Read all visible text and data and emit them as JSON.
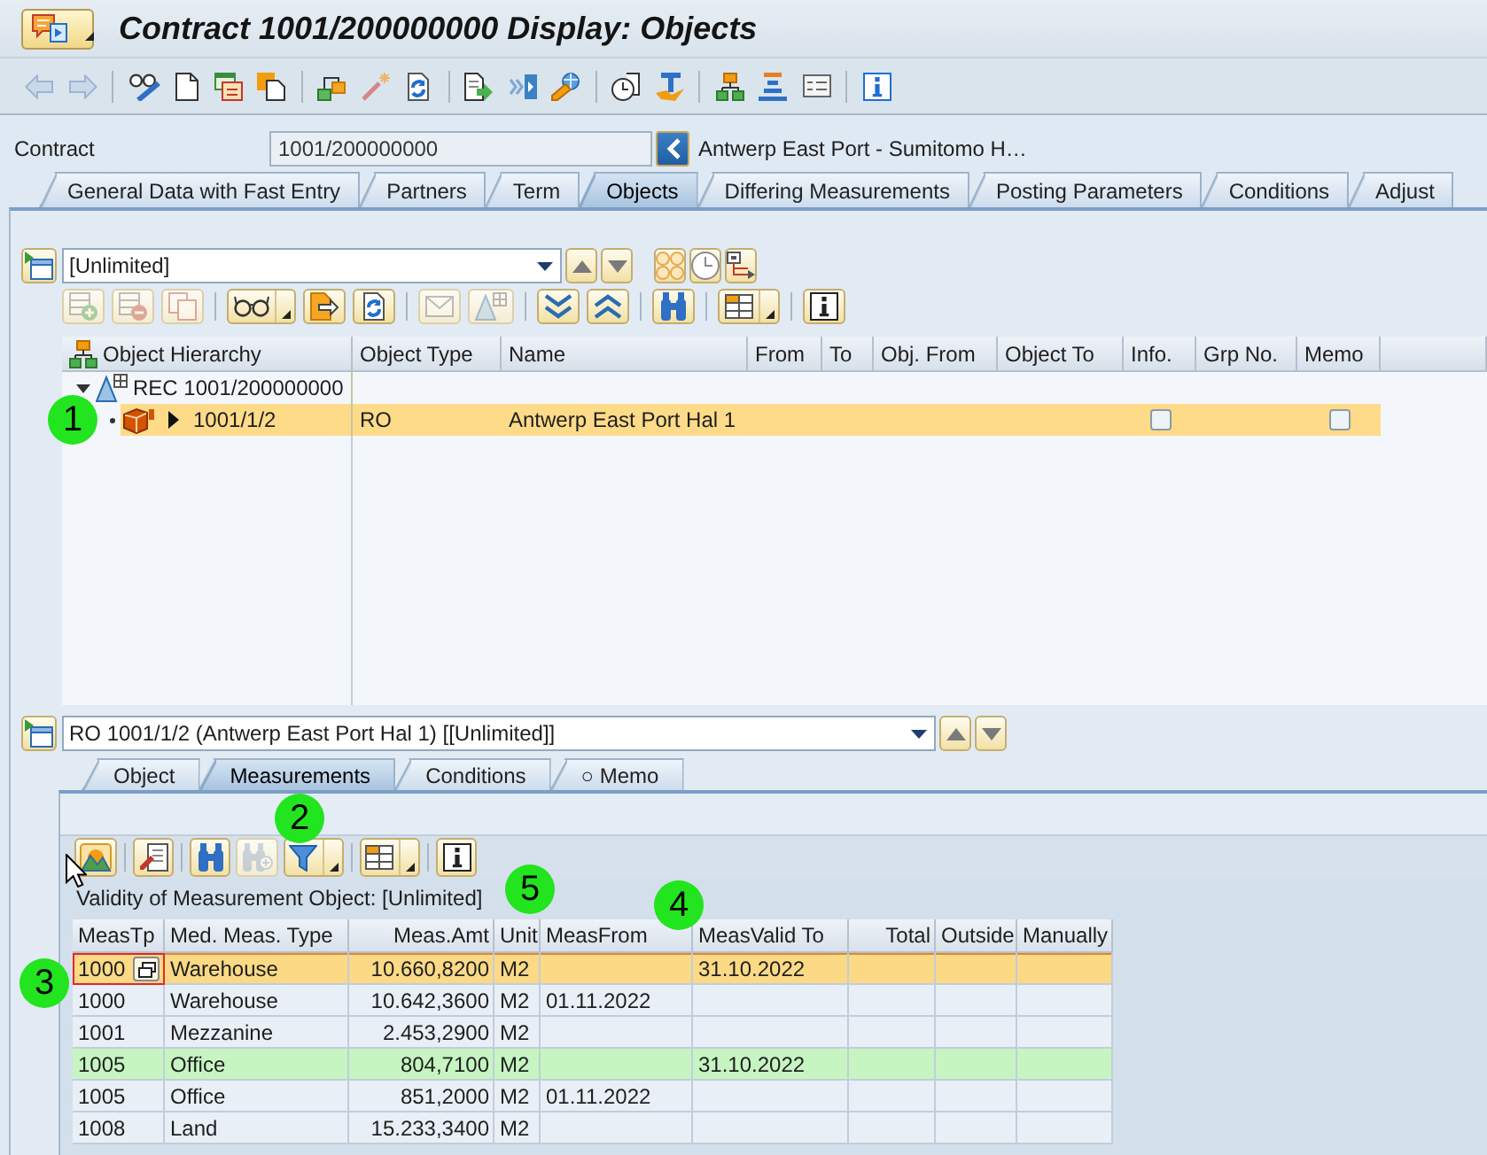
{
  "window": {
    "title": "Contract 1001/200000000 Display: Objects"
  },
  "toolbar": [
    {
      "disabled": true
    },
    {
      "disabled": true
    },
    {
      "disabled": false
    },
    {
      "disabled": false
    },
    {
      "disabled": false
    },
    {
      "disabled": false
    },
    {
      "disabled": false
    },
    {
      "disabled": false
    },
    {
      "disabled": false
    },
    {
      "disabled": false
    },
    {
      "disabled": false
    },
    {
      "disabled": false
    },
    {
      "disabled": false
    },
    {
      "disabled": false
    },
    {
      "disabled": false
    },
    {
      "disabled": false
    },
    {
      "disabled": false
    },
    {
      "disabled": false
    }
  ],
  "header": {
    "label": "Contract",
    "value": "1001/200000000",
    "description": "Antwerp East Port - Sumitomo H…"
  },
  "tabs": [
    {
      "label": "General Data with Fast Entry",
      "selected": false
    },
    {
      "label": "Partners",
      "selected": false
    },
    {
      "label": "Term",
      "selected": false
    },
    {
      "label": "Objects",
      "selected": true
    },
    {
      "label": "Differing Measurements",
      "selected": false
    },
    {
      "label": "Posting Parameters",
      "selected": false
    },
    {
      "label": "Conditions",
      "selected": false
    },
    {
      "label": "Adjust",
      "selected": false
    }
  ],
  "objects": {
    "variant": "[Unlimited]",
    "toolbar": [
      {
        "disabled": true
      },
      {
        "disabled": true
      },
      {
        "disabled": true
      },
      {
        "disabled": false
      },
      {
        "disabled": false
      },
      {
        "disabled": false
      },
      {
        "disabled": true
      },
      {
        "disabled": true
      },
      {
        "disabled": false
      },
      {
        "disabled": false
      },
      {
        "disabled": false
      },
      {
        "disabled": false
      },
      {
        "disabled": false
      }
    ],
    "columns": [
      "Object Hierarchy",
      "Object Type",
      "Name",
      "From",
      "To",
      "Obj. From",
      "Object To",
      "Info.",
      "Grp No.",
      "Memo"
    ],
    "tree": [
      {
        "label": "REC 1001/200000000",
        "expanded": true,
        "selected": false,
        "children": [
          {
            "label": "1001/1/2",
            "expanded": false,
            "selected": true,
            "object_type": "RO",
            "name": "Antwerp East Port Hal 1",
            "info_checked": false,
            "memo_checked": false
          }
        ]
      }
    ]
  },
  "detail": {
    "title": "RO 1001/1/2 (Antwerp East Port Hal 1) [[Unlimited]]",
    "tabs": [
      {
        "label": "Object",
        "selected": false
      },
      {
        "label": "Measurements",
        "selected": true
      },
      {
        "label": "Conditions",
        "selected": false
      },
      {
        "label": "○ Memo",
        "selected": false
      }
    ],
    "toolbar": [
      {
        "disabled": false
      },
      {
        "disabled": false
      },
      {
        "disabled": false
      },
      {
        "disabled": true
      },
      {
        "disabled": false
      },
      {
        "disabled": false
      },
      {
        "disabled": false
      }
    ],
    "validity": "Validity of Measurement Object: [Unlimited]",
    "columns": [
      {
        "label": "MeasTp",
        "kind": "text"
      },
      {
        "label": "Med. Meas. Type",
        "kind": "text"
      },
      {
        "label": "Meas.Amt",
        "kind": "number"
      },
      {
        "label": "Unit",
        "kind": "text"
      },
      {
        "label": "MeasFrom",
        "kind": "text"
      },
      {
        "label": "MeasValid To",
        "kind": "text"
      },
      {
        "label": "Total",
        "kind": "number"
      },
      {
        "label": "Outside",
        "kind": "text"
      },
      {
        "label": "Manually",
        "kind": "text"
      }
    ],
    "rows": [
      {
        "selected": true,
        "focused": true,
        "meas_type": "1000",
        "med_meas_type": "Warehouse",
        "meas_amount": "10.660,8200",
        "unit": "M2",
        "meas_valid_to": "31.10.2022"
      },
      {
        "selected": false,
        "focused": false,
        "meas_type": "1000",
        "med_meas_type": "Warehouse",
        "meas_amount": "10.642,3600",
        "unit": "M2",
        "meas_from": "01.11.2022"
      },
      {
        "selected": false,
        "focused": false,
        "meas_type": "1001",
        "med_meas_type": "Mezzanine",
        "meas_amount": "2.453,2900",
        "unit": "M2"
      },
      {
        "selected": false,
        "focused": false,
        "color": "#c6f5c1",
        "meas_type": "1005",
        "med_meas_type": "Office",
        "meas_amount": "804,7100",
        "unit": "M2",
        "meas_valid_to": "31.10.2022"
      },
      {
        "selected": false,
        "focused": false,
        "meas_type": "1005",
        "med_meas_type": "Office",
        "meas_amount": "851,2000",
        "unit": "M2",
        "meas_from": "01.11.2022"
      },
      {
        "selected": false,
        "focused": false,
        "meas_type": "1008",
        "med_meas_type": "Land",
        "meas_amount": "15.233,3400",
        "unit": "M2"
      }
    ]
  },
  "annotations": [
    "1",
    "2",
    "3",
    "4",
    "5"
  ]
}
